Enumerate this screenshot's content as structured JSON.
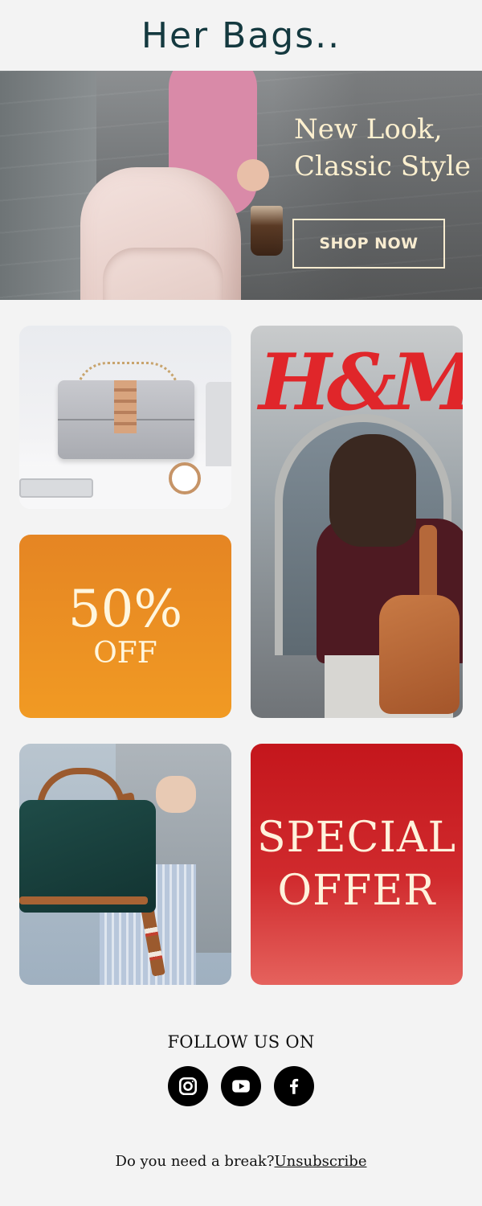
{
  "header": {
    "brand": "Her Bags.."
  },
  "hero": {
    "headline_line1": "New Look,",
    "headline_line2": "Classic Style",
    "cta": "SHOP NOW"
  },
  "promo_discount": {
    "percent": "50%",
    "label": "OFF"
  },
  "promo_special": {
    "line1": "SPECIAL",
    "line2": "OFFER"
  },
  "store_sign": "H&M",
  "footer": {
    "follow_label": "FOLLOW US ON",
    "socials": [
      "instagram-icon",
      "youtube-icon",
      "facebook-icon"
    ],
    "break_text": "Do you need a break?",
    "unsubscribe_label": "Unsubscribe"
  },
  "colors": {
    "brand_text": "#14393f",
    "page_bg": "#f3f3f3",
    "discount_tile": "#ec8e22",
    "special_tile": "#c9191e",
    "hero_text": "#fdf0cf"
  }
}
